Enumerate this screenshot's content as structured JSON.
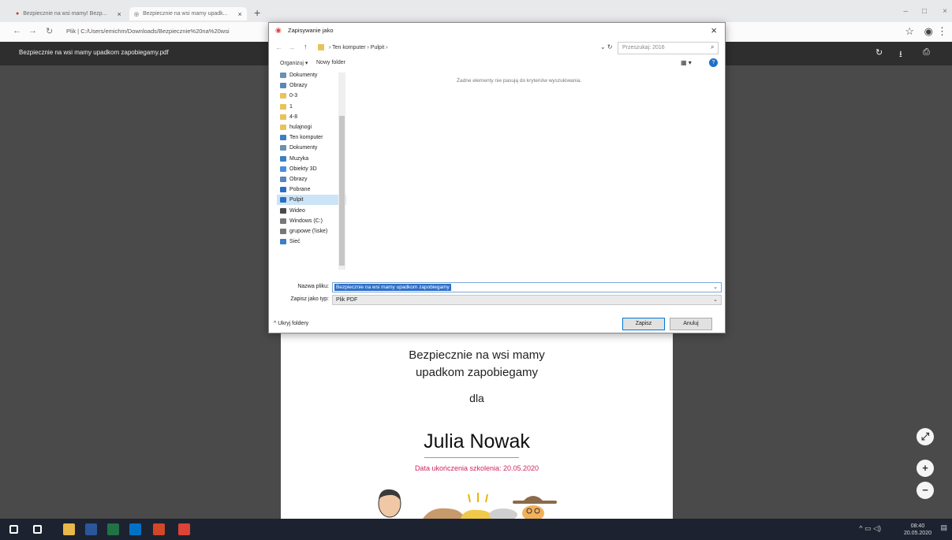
{
  "browser": {
    "tabs": [
      {
        "label": "Bezpiecznie na wsi mamy! Bezp...",
        "close": "×"
      },
      {
        "label": "Bezpiecznie na wsi mamy upadk...",
        "close": "×"
      }
    ],
    "new_tab": "+",
    "url": "Plik  |  C:/Users/emichm/Downloads/Bezpiecznie%20na%20wsi",
    "window_controls": [
      "–",
      "□",
      "×"
    ]
  },
  "pdf": {
    "filename": "Bezpiecznie na wsi mamy upadkom zapobiegamy.pdf",
    "certificate": {
      "line1": "Bezpiecznie na wsi mamy",
      "line2": "upadkom zapobiegamy",
      "for": "dla",
      "name": "Julia Nowak",
      "date": "Data ukończenia szkolenia: 20.05.2020"
    },
    "zoom": {
      "fit": "⤢",
      "in": "+",
      "out": "−"
    }
  },
  "dialog": {
    "title": "Zapisywanie jako",
    "breadcrumb": "›  Ten komputer  ›  Pulpit  ›",
    "search_placeholder": "Przeszukaj: 2016",
    "organize": "Organizuj ▾",
    "new_folder": "Nowy folder",
    "empty_message": "Żadne elementy nie pasują do kryteriów wyszukiwania.",
    "nav_items": [
      {
        "label": "Dokumenty",
        "icon": "documents-icon",
        "color": "#6b8fb5"
      },
      {
        "label": "Obrazy",
        "icon": "pictures-icon",
        "color": "#5a87b7"
      },
      {
        "label": "0-3",
        "icon": "folder-icon",
        "color": "#e8c35a"
      },
      {
        "label": "1",
        "icon": "folder-icon",
        "color": "#e8c35a"
      },
      {
        "label": "4-8",
        "icon": "folder-icon",
        "color": "#e8c35a"
      },
      {
        "label": "hulajnogi",
        "icon": "folder-icon",
        "color": "#e8c35a"
      },
      {
        "label": "Ten komputer",
        "icon": "computer-icon",
        "color": "#3b7fc4"
      },
      {
        "label": "Dokumenty",
        "icon": "documents-icon",
        "color": "#6b8fb5"
      },
      {
        "label": "Muzyka",
        "icon": "music-icon",
        "color": "#3b7fc4"
      },
      {
        "label": "Obiekty 3D",
        "icon": "objects3d-icon",
        "color": "#4a90d9"
      },
      {
        "label": "Obrazy",
        "icon": "pictures-icon",
        "color": "#5a87b7"
      },
      {
        "label": "Pobrane",
        "icon": "downloads-icon",
        "color": "#2b6fc2"
      },
      {
        "label": "Pulpit",
        "icon": "desktop-icon",
        "color": "#2b6fc2"
      },
      {
        "label": "Wideo",
        "icon": "video-icon",
        "color": "#4a4a4a"
      },
      {
        "label": "Windows (C:)",
        "icon": "drive-icon",
        "color": "#777777"
      },
      {
        "label": "grupowe (\\\\ske)",
        "icon": "network-drive-icon",
        "color": "#777777"
      },
      {
        "label": "Sieć",
        "icon": "network-icon",
        "color": "#3b7fc4"
      }
    ],
    "selected_nav": "Pulpit",
    "file_name_label": "Nazwa pliku:",
    "file_name_value": "Bezpiecznie na wsi mamy upadkom zapobiegamy",
    "file_type_label": "Zapisz jako typ:",
    "file_type_value": "Plik PDF",
    "hide_folders": "Ukryj foldery",
    "save_button": "Zapisz",
    "cancel_button": "Anuluj"
  },
  "taskbar": {
    "time": "08:40",
    "date": "20.05.2020",
    "apps": [
      {
        "icon": "start-icon",
        "color": "#ffffff"
      },
      {
        "icon": "search-icon",
        "color": "#ffffff"
      },
      {
        "icon": "file-explorer-icon",
        "color": "#e8b84a"
      },
      {
        "icon": "word-icon",
        "color": "#2b579a"
      },
      {
        "icon": "excel-icon",
        "color": "#217346"
      },
      {
        "icon": "outlook-icon",
        "color": "#0072c6"
      },
      {
        "icon": "powerpoint-icon",
        "color": "#d24726"
      },
      {
        "icon": "chrome-icon",
        "color": "#db4437"
      }
    ]
  }
}
